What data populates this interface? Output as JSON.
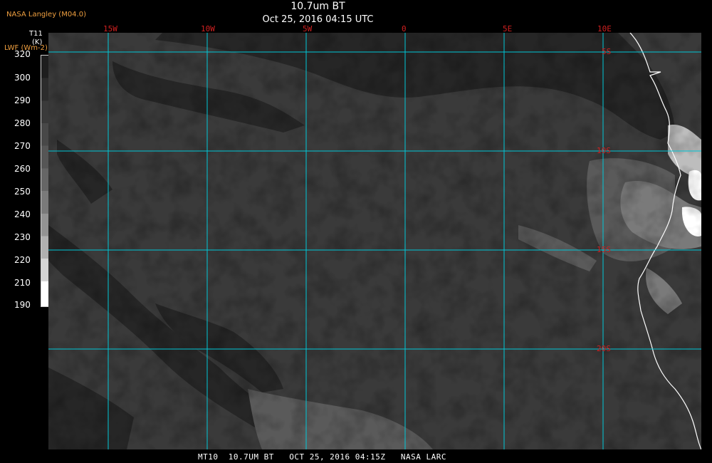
{
  "header": {
    "credit": "NASA Langley (M04.0)",
    "title": "10.7um BT",
    "subtitle": "Oct 25, 2016 04:15 UTC"
  },
  "colorbar": {
    "label_line1": "T11",
    "label_line2": "(K)",
    "label_line3": "LWF (Wm-2)",
    "ticks": [
      "320",
      "300",
      "290",
      "280",
      "270",
      "260",
      "250",
      "240",
      "230",
      "220",
      "210",
      "190"
    ]
  },
  "map": {
    "longitude_labels": [
      "15W",
      "10W",
      "5W",
      "0",
      "5E",
      "10E"
    ],
    "latitude_labels": [
      "5S",
      "10S",
      "15S",
      "20S"
    ],
    "grid_color": "#00c8d8",
    "label_color": "#d02020",
    "coastline_color": "#ffffff"
  },
  "footer": {
    "caption": "MT10  10.7UM BT   OCT 25, 2016 04:15Z   NASA LARC"
  }
}
